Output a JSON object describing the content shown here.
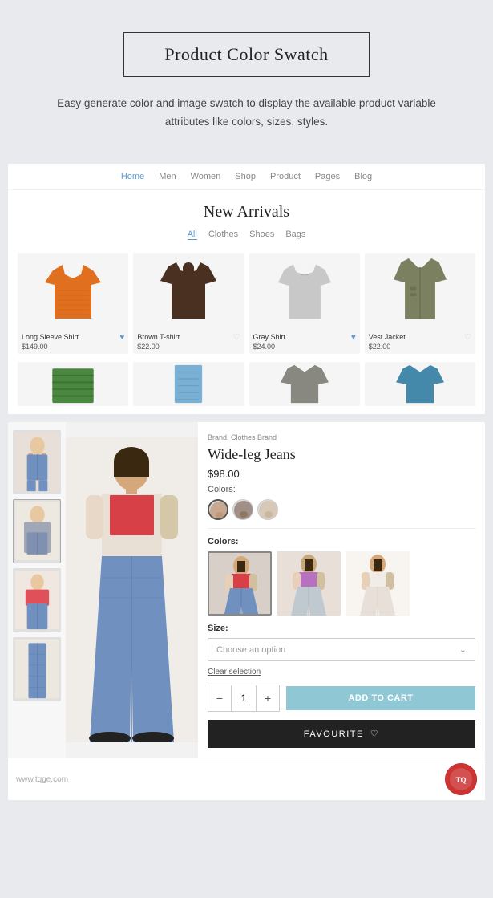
{
  "header": {
    "title": "Product Color Swatch",
    "subtitle": "Easy generate color and image swatch to display the available product variable attributes like colors, sizes, styles."
  },
  "shop": {
    "nav_items": [
      "Home",
      "Men",
      "Women",
      "Shop",
      "Product",
      "Pages",
      "Blog"
    ],
    "nav_active": "Home",
    "section_title": "New Arrivals",
    "filter_tabs": [
      "All",
      "Clothes",
      "Shoes",
      "Bags"
    ],
    "filter_active": "All",
    "products": [
      {
        "name": "Long Sleeve Shirt",
        "price": "$149.00",
        "heart": "filled"
      },
      {
        "name": "Brown T-shirt",
        "price": "$22.00",
        "heart": "outline"
      },
      {
        "name": "Gray Shirt",
        "price": "$24.00",
        "heart": "filled"
      },
      {
        "name": "Vest Jacket",
        "price": "$22.00",
        "heart": "outline"
      }
    ]
  },
  "product_detail": {
    "brand": "Brand, Clothes Brand",
    "name": "Wide-leg Jeans",
    "price": "$98.00",
    "colors_label": "Colors:",
    "size_label": "Size:",
    "size_placeholder": "Choose an option",
    "clear_label": "Clear selection",
    "quantity": "1",
    "add_to_cart": "ADD TO CART",
    "favourite": "FAVOURITE",
    "qty_minus": "−",
    "qty_plus": "+"
  },
  "watermark": {
    "site": "www.tqge.com"
  }
}
